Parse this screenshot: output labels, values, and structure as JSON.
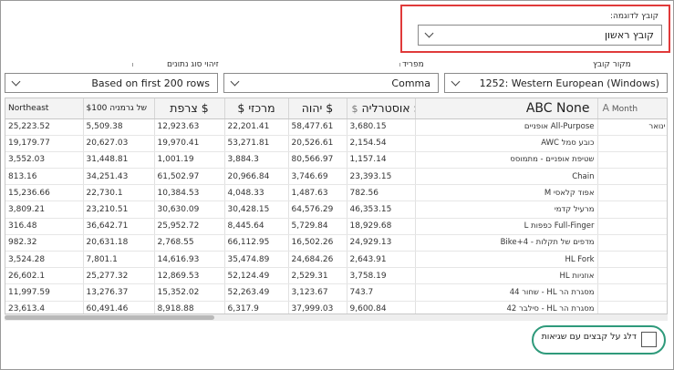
{
  "sample_file": {
    "label": "קובץ לדוגמה:",
    "value": "קובץ ראשון"
  },
  "file_origin": {
    "label": "מקור קובץ",
    "value": "1252: Western European (Windows)"
  },
  "delimiter": {
    "label": "מפריד",
    "value": "Comma"
  },
  "data_type_detection": {
    "label": "זיהוי סוג נתונים",
    "value": "Based on first 200 rows"
  },
  "table": {
    "headers": {
      "month": "Month",
      "product": "ABC None",
      "australia": "אוסטרליה $",
      "israel": "יהוה $",
      "central": "$ מרכזי",
      "france": "צרפת $",
      "germany": "$100 של גרמניה",
      "northeast": "Northeast"
    },
    "rows": [
      {
        "month": "ינואר",
        "product": "All-Purpose אופניים",
        "australia": "3,680.15",
        "israel": "58,477.61",
        "central": "22,201.41",
        "france": "12,923.63",
        "germany": "5,509.38",
        "northeast": "25,223.52"
      },
      {
        "month": "",
        "product": "כובע סמל AWC",
        "australia": "2,154.54",
        "israel": "20,526.61",
        "central": "53,271.81",
        "france": "19,970.41",
        "germany": "20,627.03",
        "northeast": "19,179.77"
      },
      {
        "month": "",
        "product": "שטיפת אופניים - מתמוסס",
        "australia": "1,157.14",
        "israel": "80,566.97",
        "central": "3,884.3",
        "france": "1,001.19",
        "germany": "31,448.81",
        "northeast": "3,552.03"
      },
      {
        "month": "",
        "product": "Chain",
        "australia": "23,393.15",
        "israel": "3,746.69",
        "central": "20,966.84",
        "france": "61,502.97",
        "germany": "34,251.43",
        "northeast": "813.16"
      },
      {
        "month": "",
        "product": "אפוד קלאסי M",
        "australia": "782.56",
        "israel": "1,487.63",
        "central": "4,048.33",
        "france": "10,384.53",
        "germany": "22,730.1",
        "northeast": "15,236.66"
      },
      {
        "month": "",
        "product": "מרעיל קדמי",
        "australia": "46,353.15",
        "israel": "64,576.29",
        "central": "30,428.15",
        "france": "30,630.09",
        "germany": "23,210.51",
        "northeast": "3,809.21"
      },
      {
        "month": "",
        "product": "Full-Finger כפפות L",
        "australia": "18,929.68",
        "israel": "5,729.84",
        "central": "8,445.64",
        "france": "25,952.72",
        "germany": "36,642.71",
        "northeast": "316.48"
      },
      {
        "month": "",
        "product": "מדפים של תקלות - Bike+4",
        "australia": "24,929.13",
        "israel": "16,502.26",
        "central": "66,112.95",
        "france": "2,768.55",
        "germany": "20,631.18",
        "northeast": "982.32"
      },
      {
        "month": "",
        "product": "HL Fork",
        "australia": "2,643.91",
        "israel": "24,684.26",
        "central": "35,474.89",
        "france": "14,616.93",
        "germany": "7,801.1",
        "northeast": "3,524.28"
      },
      {
        "month": "",
        "product": "אוזניות HL",
        "australia": "3,758.19",
        "israel": "2,529.31",
        "central": "52,124.49",
        "france": "12,869.53",
        "germany": "25,277.32",
        "northeast": "26,602.1"
      },
      {
        "month": "",
        "product": "מסגרת הר HL - שחור 44",
        "australia": "743.7",
        "israel": "3,123.67",
        "central": "52,263.49",
        "france": "15,352.02",
        "germany": "13,276.37",
        "northeast": "11,997.59"
      },
      {
        "month": "",
        "product": "מסגרת הר HL - סילבר 42",
        "australia": "9,600.84",
        "israel": "37,999.03",
        "central": "6,317.9",
        "france": "8,918.88",
        "germany": "60,491.46",
        "northeast": "23,613.4"
      }
    ]
  },
  "skip_errors": {
    "label": "דלג על קבצים עם שגיאות"
  }
}
